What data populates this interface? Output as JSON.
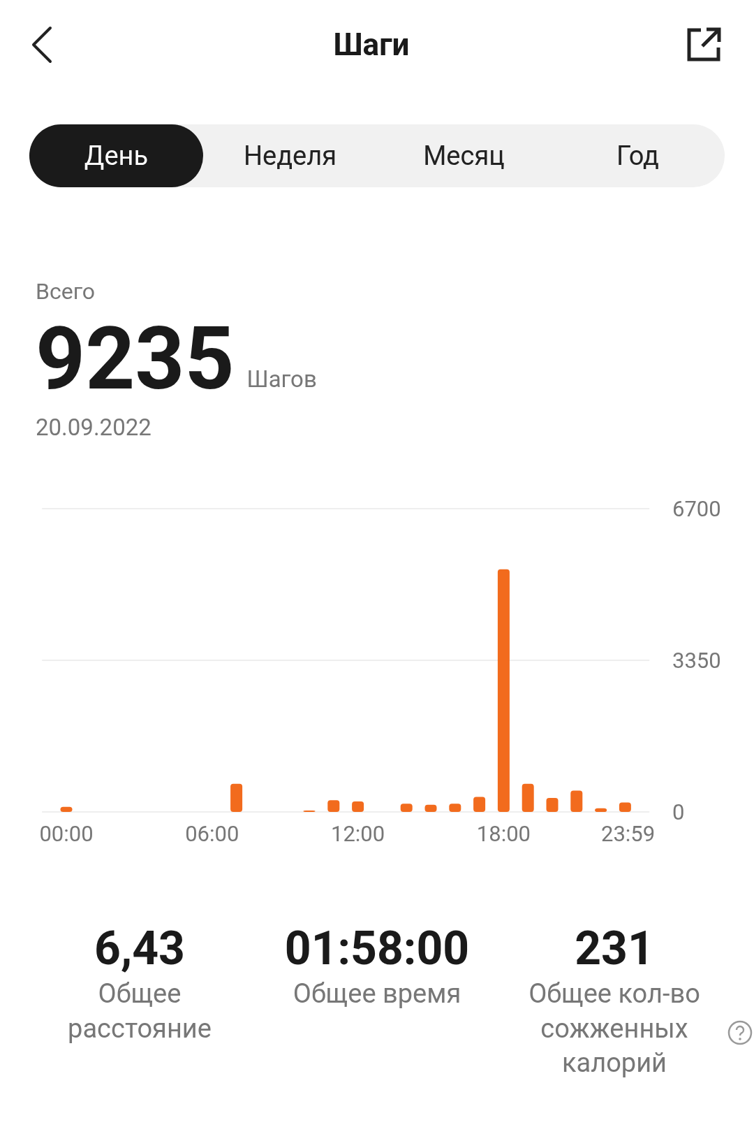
{
  "header": {
    "title": "Шаги"
  },
  "tabs": [
    {
      "label": "День",
      "selected": true
    },
    {
      "label": "Неделя",
      "selected": false
    },
    {
      "label": "Месяц",
      "selected": false
    },
    {
      "label": "Год",
      "selected": false
    }
  ],
  "summary": {
    "label": "Всего",
    "value": "9235",
    "unit": "Шагов",
    "date": "20.09.2022"
  },
  "chart_data": {
    "type": "bar",
    "x": [
      0,
      7,
      10,
      11,
      12,
      14,
      15,
      16,
      17,
      18,
      19,
      20,
      21,
      22,
      23
    ],
    "series": [
      {
        "color": "#f26b1d",
        "values": [
          110,
          620,
          30,
          260,
          230,
          180,
          160,
          180,
          330,
          5360,
          620,
          310,
          470,
          80,
          210
        ]
      }
    ],
    "xlim": [
      -1,
      24
    ],
    "ylim": [
      0,
      6700
    ],
    "yticks": [
      0,
      3350,
      6700
    ],
    "xticks": [
      {
        "value": 0,
        "label": "00:00"
      },
      {
        "value": 6,
        "label": "06:00"
      },
      {
        "value": 12,
        "label": "12:00"
      },
      {
        "value": 18,
        "label": "18:00"
      },
      {
        "value": 23.98,
        "label": "23:59"
      }
    ]
  },
  "stats": [
    {
      "value": "6,43",
      "label": "Общее расстояние",
      "help": false
    },
    {
      "value": "01:58:00",
      "label": "Общее время",
      "help": false
    },
    {
      "value": "231",
      "label": "Общее кол-во сожженных калорий",
      "help": true
    }
  ]
}
